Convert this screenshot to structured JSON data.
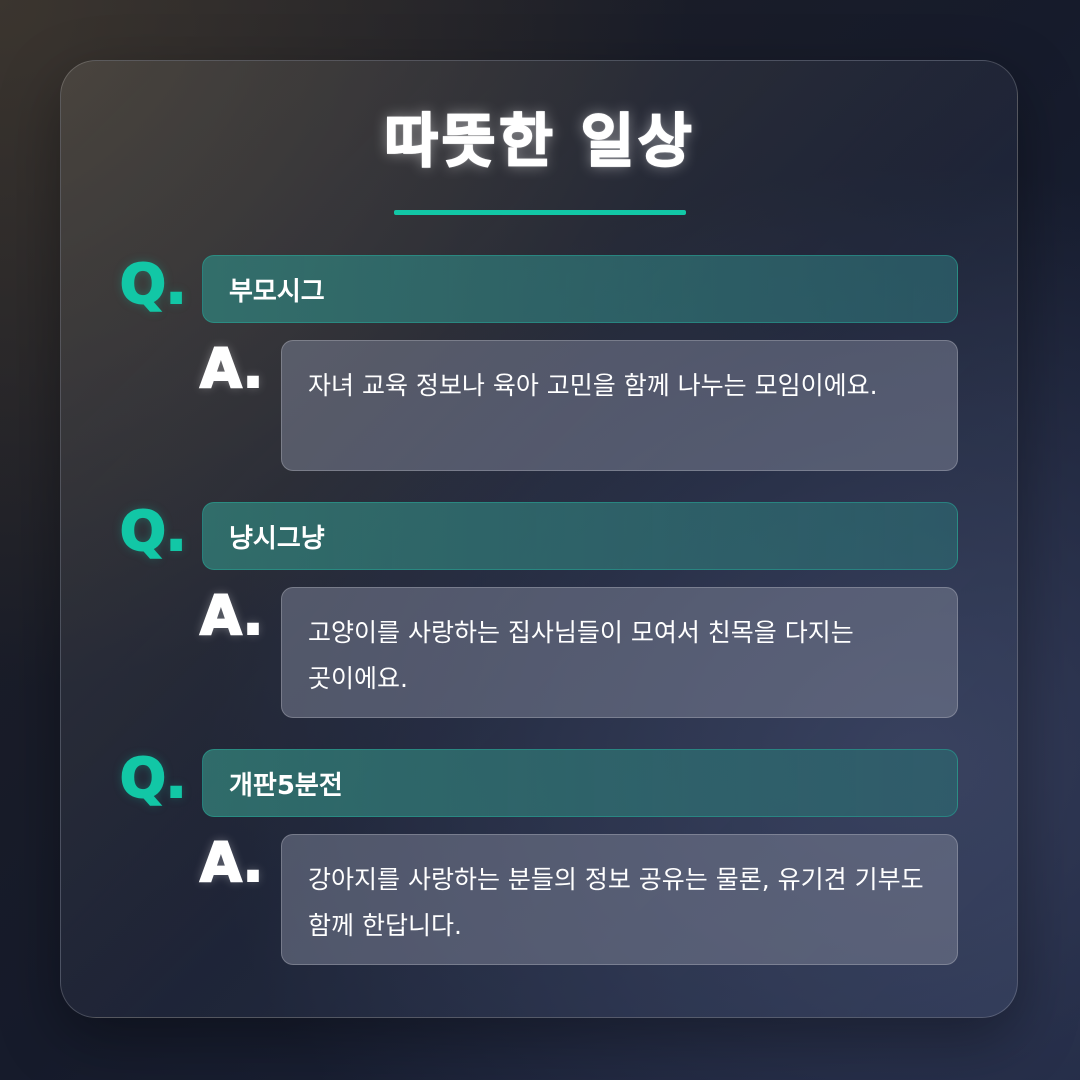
{
  "title": "따뜻한 일상",
  "q_marker": "Q.",
  "a_marker": "A.",
  "colors": {
    "accent": "#12c7a6",
    "question_bg": "#2f7370",
    "answer_bg": "#5d6275",
    "text": "#ffffff"
  },
  "faq": [
    {
      "question": "부모시그",
      "answer": "자녀 교육 정보나 육아 고민을 함께 나누는 모임이에요."
    },
    {
      "question": "냥시그냥",
      "answer": "고양이를 사랑하는 집사님들이 모여서 친목을 다지는 곳이에요."
    },
    {
      "question": "개판5분전",
      "answer": "강아지를 사랑하는 분들의 정보 공유는 물론, 유기견 기부도 함께 한답니다."
    }
  ]
}
